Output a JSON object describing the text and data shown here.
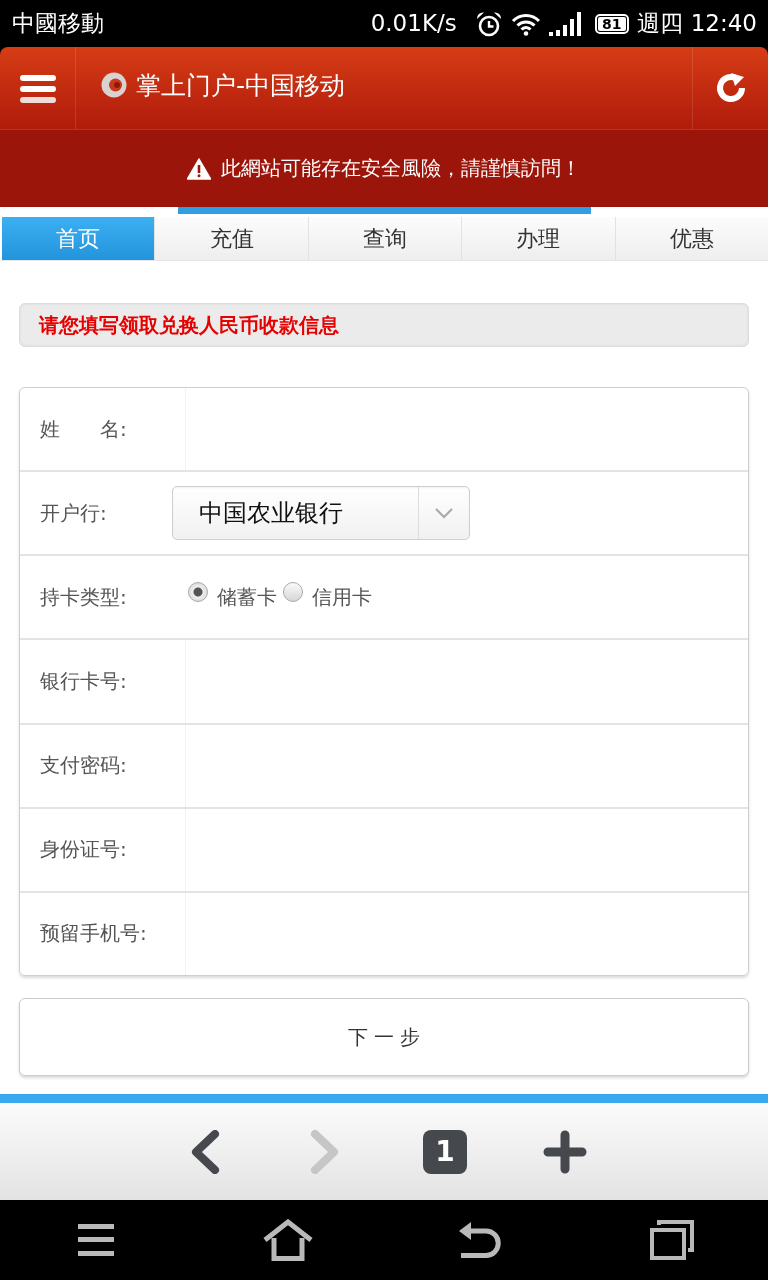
{
  "status_bar": {
    "carrier": "中國移動",
    "speed": "0.01K/s",
    "battery": "81",
    "day": "週四",
    "time": "12:40"
  },
  "header": {
    "title": "掌上门户-中国移动"
  },
  "warning": {
    "text": "此網站可能存在安全風險，請謹慎訪問！"
  },
  "page_load": {
    "level": 0.7
  },
  "tabs": [
    {
      "label": "首页",
      "selected": true
    },
    {
      "label": "充值",
      "selected": false
    },
    {
      "label": "查询",
      "selected": false
    },
    {
      "label": "办理",
      "selected": false
    },
    {
      "label": "优惠",
      "selected": false
    }
  ],
  "notice": {
    "text": "请您填写领取兑换人民币收款信息"
  },
  "form": {
    "rows": [
      {
        "kind": "text",
        "label": "姓　　名:"
      },
      {
        "kind": "select",
        "label": "开户行:",
        "value": "中国农业银行"
      },
      {
        "kind": "radio",
        "label": "持卡类型:",
        "options": [
          {
            "label": "储蓄卡",
            "selected": true
          },
          {
            "label": "信用卡",
            "selected": false
          }
        ]
      },
      {
        "kind": "text",
        "label": "银行卡号:"
      },
      {
        "kind": "password",
        "label": "支付密码:"
      },
      {
        "kind": "text",
        "label": "身份证号:"
      },
      {
        "kind": "text",
        "label": "预留手机号:"
      }
    ]
  },
  "next_button": {
    "label": "下 一 步"
  },
  "browser_toolbar": {
    "buttons": [
      {
        "kind": "back",
        "disabled": false
      },
      {
        "kind": "forward",
        "disabled": true
      },
      {
        "kind": "tabs",
        "label": "1",
        "disabled": false
      },
      {
        "kind": "new_tab",
        "disabled": false
      }
    ]
  }
}
